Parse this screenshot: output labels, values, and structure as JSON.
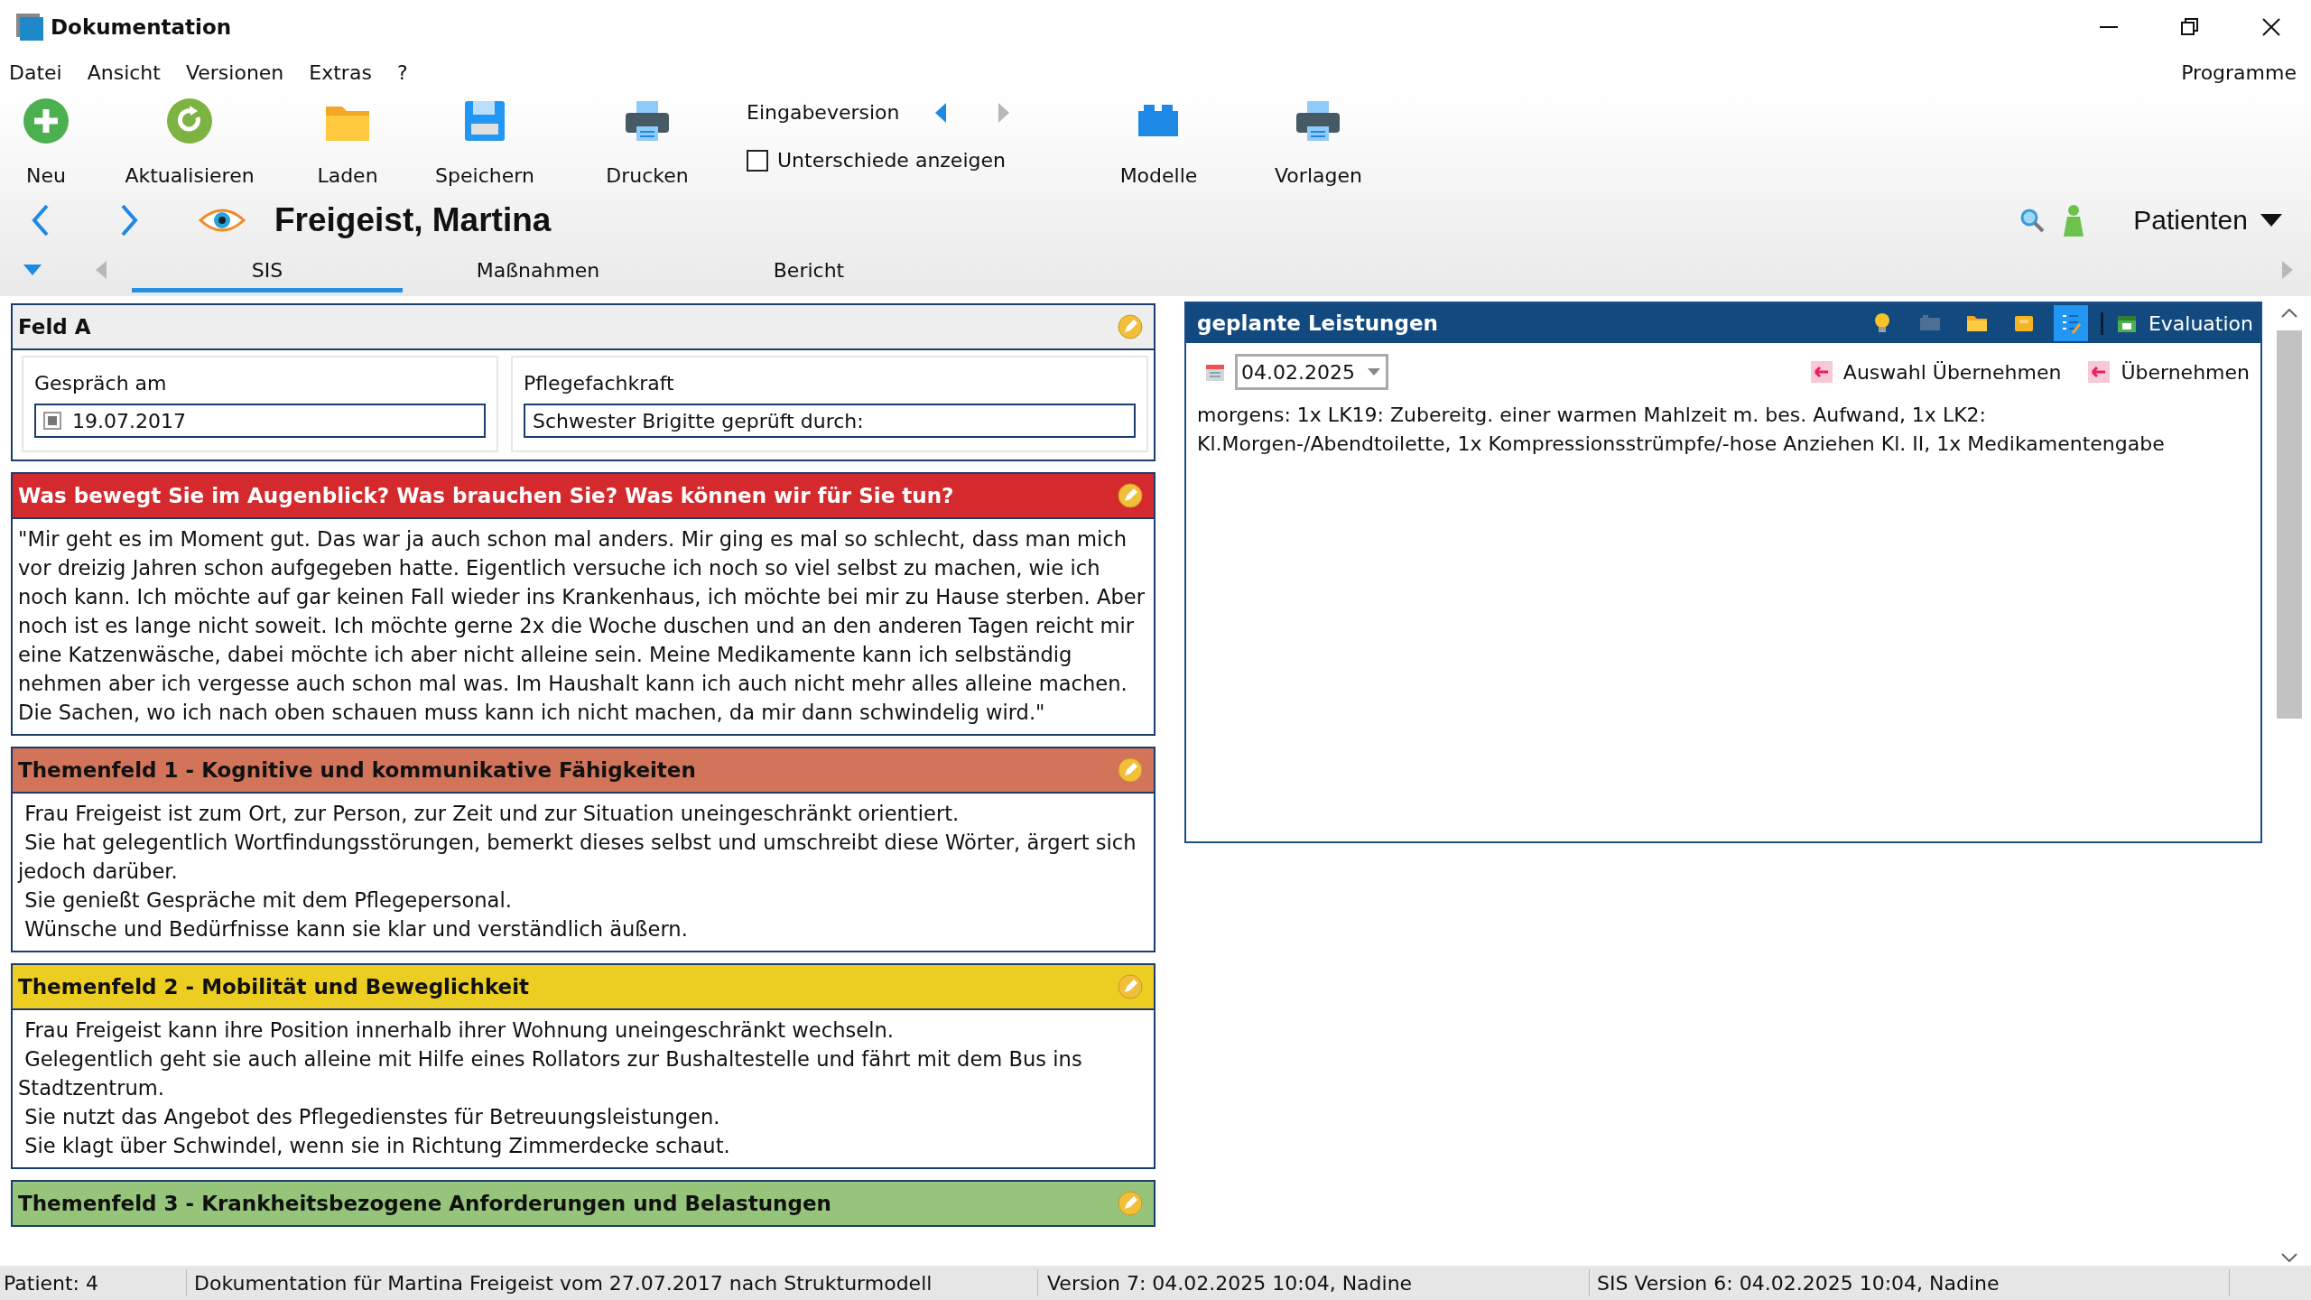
{
  "window": {
    "title": "Dokumentation"
  },
  "menu": [
    "Datei",
    "Ansicht",
    "Versionen",
    "Extras",
    "?"
  ],
  "menu_right": "Programme",
  "toolbar": [
    {
      "label": "Neu"
    },
    {
      "label": "Aktualisieren"
    },
    {
      "label": "Laden"
    },
    {
      "label": "Speichern"
    },
    {
      "label": "Drucken"
    }
  ],
  "version": {
    "label": "Eingabeversion",
    "prev_disabled": false,
    "next_disabled": true,
    "compare": {
      "label": "Unterschiede anzeigen",
      "checked": false
    }
  },
  "toolbar_right": [
    {
      "label": "Modelle"
    },
    {
      "label": "Vorlagen"
    }
  ],
  "patient": {
    "name": "Freigeist, Martina",
    "selector": "Patienten"
  },
  "tabs": [
    {
      "label": "SIS",
      "selected": true
    },
    {
      "label": "Maßnahmen",
      "selected": false
    },
    {
      "label": "Bericht",
      "selected": false
    }
  ],
  "feld_a": {
    "title": "Feld A",
    "fields": [
      {
        "label": "Gespräch am",
        "value": "19.07.2017",
        "checked": true
      },
      {
        "label": "Pflegefachkraft",
        "value": "Schwester Brigitte geprüft durch:"
      }
    ]
  },
  "sections": [
    {
      "title": "Was bewegt Sie im Augenblick? Was brauchen Sie? Was können wir für Sie tun?",
      "color": "#d42a2e",
      "light_title": true,
      "paragraphs": [
        "\"Mir geht es im Moment gut. Das war ja auch schon mal anders. Mir ging es mal so schlecht, dass man mich vor dreizig Jahren schon aufgegeben hatte. Eigentlich versuche ich noch so viel selbst zu machen, wie ich noch kann. Ich möchte auf gar keinen Fall wieder ins Krankenhaus, ich möchte bei mir zu Hause sterben. Aber noch ist es lange nicht soweit. Ich möchte gerne 2x die Woche duschen und an den anderen Tagen reicht mir eine Katzenwäsche, dabei möchte ich aber nicht alleine sein. Meine Medikamente kann ich selbständig nehmen aber ich vergesse auch schon mal was. Im Haushalt kann ich auch nicht mehr alles alleine machen. Die Sachen, wo ich nach oben schauen muss kann ich nicht machen, da mir dann schwindelig wird.\""
      ]
    },
    {
      "title": "Themenfeld 1 - Kognitive und kommunikative Fähigkeiten",
      "color": "#d2745a",
      "light_title": false,
      "paragraphs": [
        " Frau Freigeist ist zum Ort, zur Person, zur Zeit und zur Situation uneingeschränkt orientiert.",
        " Sie hat gelegentlich Wortfindungsstörungen, bemerkt dieses selbst und umschreibt diese Wörter, ärgert sich jedoch darüber.",
        " Sie genießt Gespräche mit dem Pflegepersonal.",
        " Wünsche und Bedürfnisse kann sie klar und verständlich äußern."
      ]
    },
    {
      "title": "Themenfeld 2 - Mobilität und Beweglichkeit",
      "color": "#eccd22",
      "light_title": false,
      "paragraphs": [
        " Frau Freigeist kann ihre Position innerhalb ihrer Wohnung uneingeschränkt wechseln.",
        " Gelegentlich geht sie auch alleine mit Hilfe eines Rollators zur Bushaltestelle und fährt mit dem Bus ins Stadtzentrum.",
        " Sie nutzt das Angebot des Pflegedienstes für Betreuungsleistungen.",
        " Sie klagt über Schwindel, wenn sie in Richtung Zimmerdecke schaut."
      ]
    },
    {
      "title": "Themenfeld 3 - Krankheitsbezogene Anforderungen und Belastungen",
      "color": "#95c47a",
      "light_title": false
    }
  ],
  "planned": {
    "title": "geplante Leistungen",
    "tools": [
      {
        "selected": false
      },
      {
        "selected": false
      },
      {
        "selected": false
      },
      {
        "selected": false
      },
      {
        "selected": true
      }
    ],
    "evaluation": "Evaluation",
    "date": "04.02.2025",
    "actions": [
      "Auswahl Übernehmen",
      "Übernehmen"
    ],
    "text": "morgens: 1x LK19: Zubereitg. einer warmen Mahlzeit m. bes. Aufwand, 1x LK2: Kl.Morgen-/Abendtoilette, 1x Kompressionsstrümpfe/-hose Anziehen Kl. II, 1x Medikamentengabe"
  },
  "status_bar": [
    "Patient: 4",
    "Dokumentation für Martina Freigeist vom 27.07.2017 nach Strukturmodell",
    "Version 7: 04.02.2025 10:04, Nadine",
    "SIS Version 6: 04.02.2025 10:04, Nadine"
  ]
}
